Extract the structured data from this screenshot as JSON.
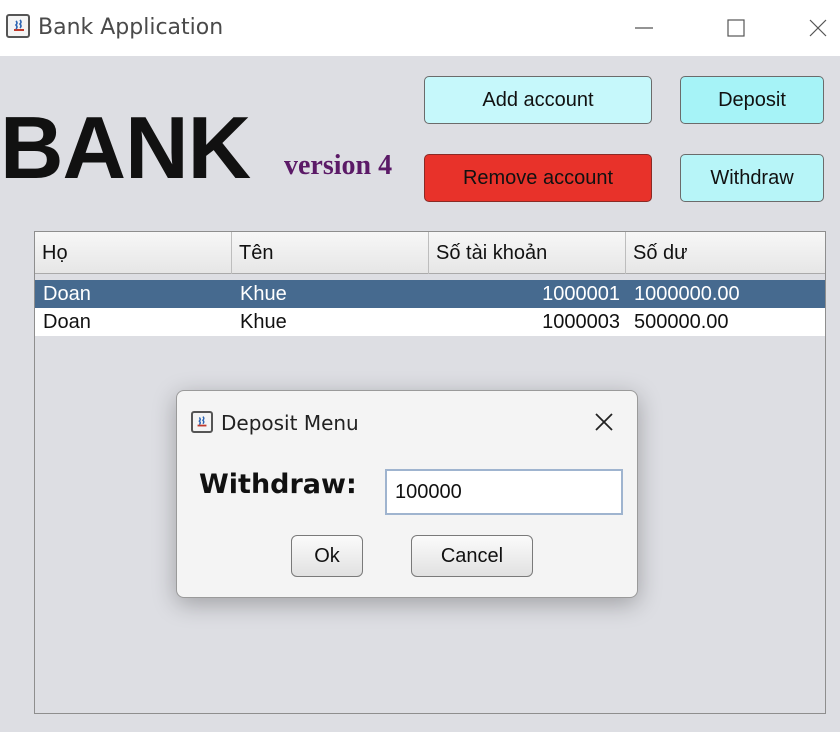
{
  "window": {
    "title": "Bank Application",
    "controls": [
      "minimize",
      "maximize",
      "close"
    ]
  },
  "header": {
    "logo": "BANK",
    "version": "version 4",
    "logo_color": "#111111",
    "version_color": "#5b1a67"
  },
  "toolbar": {
    "add_account": "Add account",
    "deposit": "Deposit",
    "remove_account": "Remove account",
    "withdraw": "Withdraw",
    "colors": {
      "add_account": "#c6f8fb",
      "deposit": "#a6f3f7",
      "remove_account": "#e8322a",
      "withdraw": "#b7f5f8"
    }
  },
  "table": {
    "columns": [
      "Họ",
      "Tên",
      "Số tài khoản",
      "Số dư"
    ],
    "rows": [
      [
        "Doan",
        "Khue",
        "1000001",
        "1000000.00"
      ],
      [
        "Doan",
        "Khue",
        "1000003",
        "500000.00"
      ]
    ],
    "selected_row": 0,
    "selected_color": "#466a8f"
  },
  "dialog": {
    "title": "Deposit Menu",
    "label": "Withdraw:",
    "input_value": "100000",
    "ok": "Ok",
    "cancel": "Cancel"
  },
  "icons": {
    "app": "java-coffee-cup-icon",
    "dialog": "java-coffee-cup-icon",
    "close": "close-icon"
  }
}
